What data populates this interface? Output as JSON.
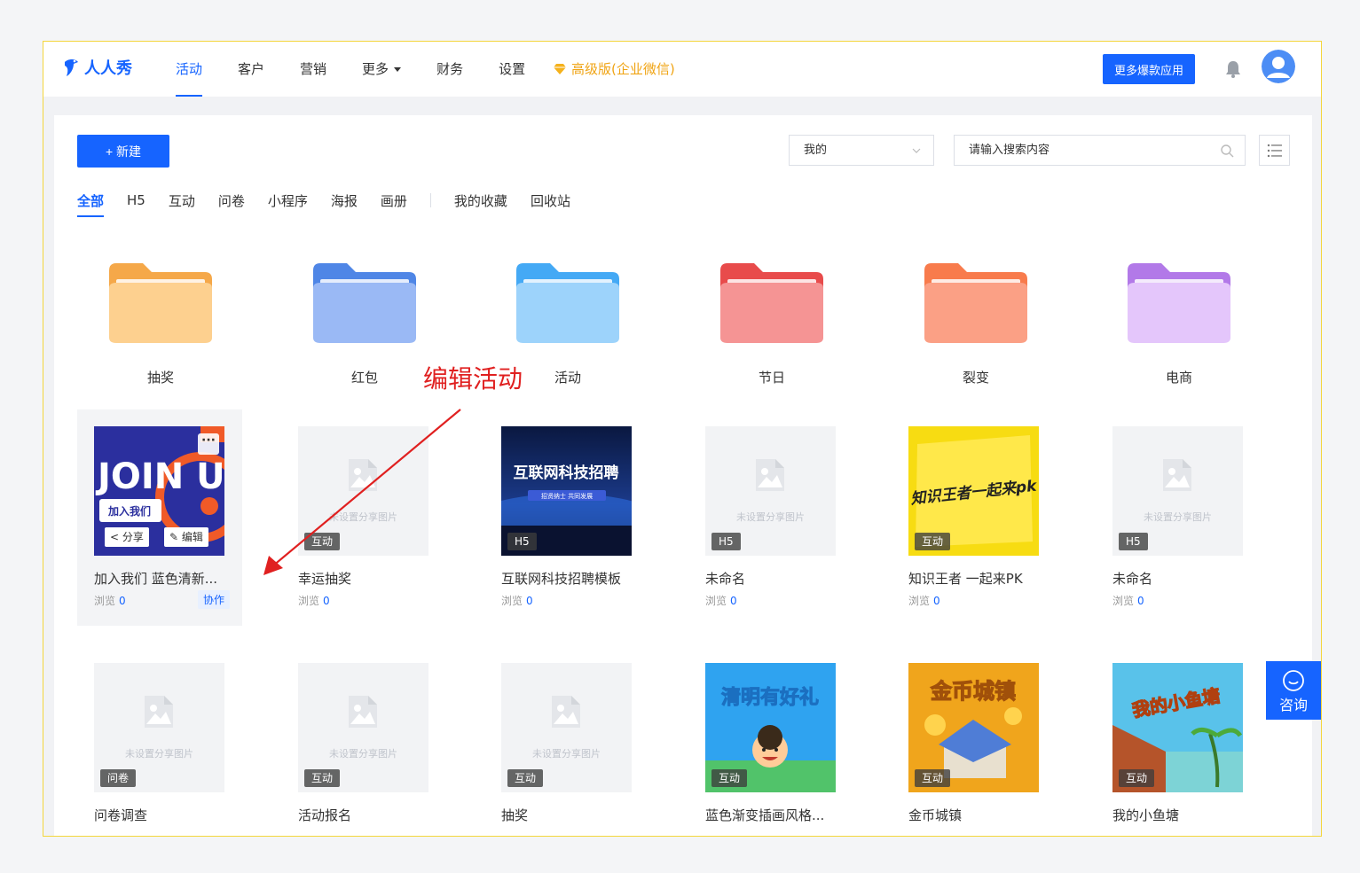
{
  "brand": {
    "name": "人人秀",
    "color": "#1664ff"
  },
  "nav": {
    "items": [
      {
        "label": "活动",
        "active": true
      },
      {
        "label": "客户"
      },
      {
        "label": "营销"
      },
      {
        "label": "更多",
        "dropdown": true
      },
      {
        "label": "财务"
      },
      {
        "label": "设置"
      }
    ],
    "premium_label": "高级版(企业微信)",
    "apps_button": "更多爆款应用"
  },
  "toolbar": {
    "new_button": "+ 新建",
    "owner_select": "我的",
    "search_placeholder": "请输入搜索内容"
  },
  "filters": [
    "全部",
    "H5",
    "互动",
    "问卷",
    "小程序",
    "海报",
    "画册",
    "我的收藏",
    "回收站"
  ],
  "folders": [
    {
      "name": "抽奖",
      "top": "#f5a849",
      "body": "#fdd08f"
    },
    {
      "name": "红包",
      "top": "#4f86e6",
      "body": "#9ab9f5"
    },
    {
      "name": "活动",
      "top": "#44a9f5",
      "body": "#9dd3fb"
    },
    {
      "name": "节日",
      "top": "#e84b4b",
      "body": "#f59494"
    },
    {
      "name": "裂变",
      "top": "#f87b4c",
      "body": "#fba085"
    },
    {
      "name": "电商",
      "top": "#b279e8",
      "body": "#e4c6fb"
    }
  ],
  "placeholder_text": "未设置分享图片",
  "views_label": "浏览",
  "card_actions": {
    "share": "分享",
    "edit": "编辑",
    "more": "···",
    "collab": "协作"
  },
  "cards_row1": [
    {
      "title": "加入我们 蓝色清新...",
      "tag": "",
      "views": "0",
      "image": "join",
      "img_title": "JOIN US",
      "img_sub": "加入我们"
    },
    {
      "title": "幸运抽奖",
      "tag": "互动",
      "views": "0",
      "image": "placeholder"
    },
    {
      "title": "互联网科技招聘模板",
      "tag": "H5",
      "views": "0",
      "image": "tech",
      "img_title": "互联网科技招聘",
      "img_sub": "招贤纳士 共同发展"
    },
    {
      "title": "未命名",
      "tag": "H5",
      "views": "0",
      "image": "placeholder"
    },
    {
      "title": "知识王者 一起来PK",
      "tag": "互动",
      "views": "0",
      "image": "quiz",
      "img_title": "知识王者一起来pk"
    },
    {
      "title": "未命名",
      "tag": "H5",
      "views": "0",
      "image": "placeholder"
    }
  ],
  "cards_row2": [
    {
      "title": "问卷调查",
      "tag": "问卷",
      "image": "placeholder"
    },
    {
      "title": "活动报名",
      "tag": "互动",
      "image": "placeholder"
    },
    {
      "title": "抽奖",
      "tag": "互动",
      "image": "placeholder"
    },
    {
      "title": "蓝色渐变插画风格...",
      "tag": "互动",
      "image": "qingming",
      "img_title": "清明有好礼"
    },
    {
      "title": "金币城镇",
      "tag": "互动",
      "image": "gold",
      "img_title": "金币城镇"
    },
    {
      "title": "我的小鱼塘",
      "tag": "互动",
      "image": "fish",
      "img_title": "我的小鱼塘"
    }
  ],
  "annotation": "编辑活动",
  "consult_label": "咨询"
}
